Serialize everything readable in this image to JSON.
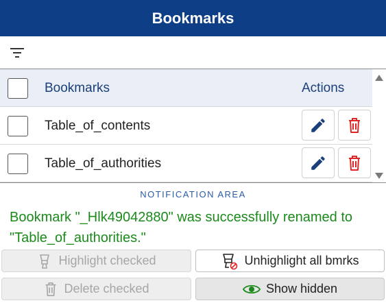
{
  "header": {
    "title": "Bookmarks"
  },
  "toolbar": {
    "filter_icon": "filter-icon"
  },
  "table": {
    "columns": {
      "bookmarks": "Bookmarks",
      "actions": "Actions"
    },
    "rows": [
      {
        "name": "Table_of_contents"
      },
      {
        "name": "Table_of_authorities"
      }
    ]
  },
  "notification": {
    "label": "NOTIFICATION AREA",
    "message": "Bookmark \"_Hlk49042880\" was successfully renamed to \"Table_of_authorities.\"",
    "color": "#1b8a1b"
  },
  "buttons": {
    "highlight": "Highlight checked",
    "unhighlight": "Unhighlight all bmrks",
    "delete": "Delete checked",
    "show_hidden": "Show hidden"
  },
  "colors": {
    "header_bg": "#0e3f86",
    "edit_icon": "#1b3f7a",
    "delete_icon": "#e02424",
    "eye_icon": "#1b8a1b"
  }
}
